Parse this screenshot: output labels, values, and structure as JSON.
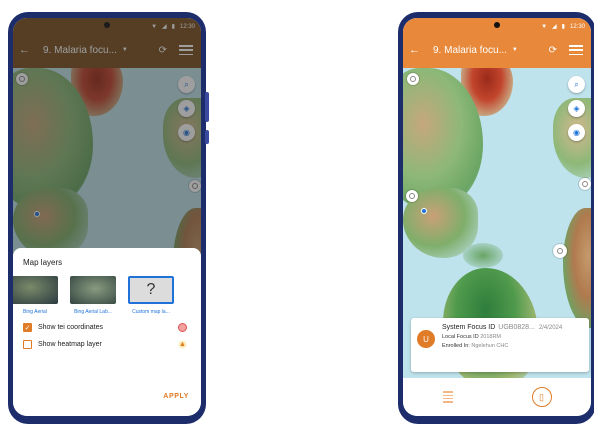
{
  "colors": {
    "appbar_left": "#7a5020",
    "appbar_right": "#e8883a",
    "accent": "#e07b27",
    "link": "#1f73d8",
    "phone_frame": "#1d2c6b"
  },
  "status_bar": {
    "time": "12:30"
  },
  "left_phone": {
    "toolbar": {
      "title": "9. Malaria focu..."
    },
    "map_layers": {
      "title": "Map layers",
      "layers": [
        {
          "label": "Bing Aerial"
        },
        {
          "label": "Bing Aerial Lab..."
        },
        {
          "label": "Custom map la..."
        }
      ],
      "custom_glyph": "?",
      "options": [
        {
          "label": "Show tei coordinates",
          "checked": true
        },
        {
          "label": "Show heatmap layer",
          "checked": false
        }
      ],
      "apply_label": "APPLY"
    }
  },
  "right_phone": {
    "toolbar": {
      "title": "9. Malaria focu..."
    },
    "card": {
      "avatar_letter": "U",
      "system_focus_key": "System Focus ID",
      "system_focus_value": "UGB0828...",
      "date": "2/4/2024",
      "local_focus_key": "Local Focus ID",
      "local_focus_value": "2018RM",
      "enrolled_key": "Enrolled In:",
      "enrolled_value": "Ngelehun CHC"
    }
  }
}
